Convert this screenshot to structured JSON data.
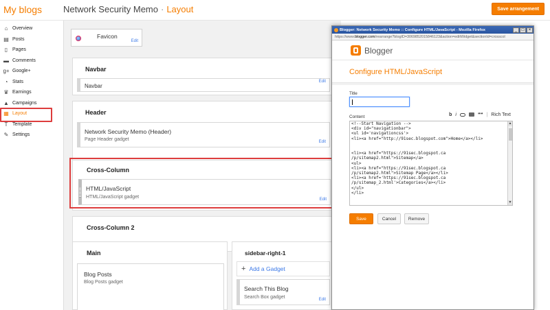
{
  "header": {
    "brand": "My blogs",
    "blog_name": "Network Security Memo",
    "separator": "·",
    "section": "Layout",
    "save_button": "Save arrangement"
  },
  "sidebar": {
    "items": [
      {
        "label": "Overview",
        "icon": "home-icon"
      },
      {
        "label": "Posts",
        "icon": "posts-icon"
      },
      {
        "label": "Pages",
        "icon": "pages-icon"
      },
      {
        "label": "Comments",
        "icon": "comments-icon"
      },
      {
        "label": "Google+",
        "icon": "googleplus-icon"
      },
      {
        "label": "Stats",
        "icon": "stats-icon"
      },
      {
        "label": "Earnings",
        "icon": "trophy-icon"
      },
      {
        "label": "Campaigns",
        "icon": "campaigns-icon"
      },
      {
        "label": "Layout",
        "icon": "layout-icon",
        "active": true
      },
      {
        "label": "Template",
        "icon": "template-icon"
      },
      {
        "label": "Settings",
        "icon": "wrench-icon"
      }
    ]
  },
  "layout": {
    "favicon": {
      "title": "Favicon",
      "edit": "Edit"
    },
    "navbar": {
      "section": "Navbar",
      "gadget_title": "Navbar",
      "edit": "Edit"
    },
    "header": {
      "section": "Header",
      "gadget_title": "Network Security Memo (Header)",
      "gadget_sub": "Page Header gadget",
      "edit": "Edit"
    },
    "cross_column": {
      "section": "Cross-Column",
      "gadget_title": "HTML/JavaScript",
      "gadget_sub": "HTML/JavaScript gadget",
      "edit": "Edit"
    },
    "cross_column_2": {
      "section": "Cross-Column 2"
    },
    "main": {
      "section": "Main",
      "gadget_title": "Blog Posts",
      "gadget_sub": "Blog Posts gadget"
    },
    "sidebar_right": {
      "section": "sidebar-right-1",
      "add_gadget": "Add a Gadget",
      "gadget_title": "Search This Blog",
      "gadget_sub": "Search Box gadget",
      "edit": "Edit"
    }
  },
  "popup": {
    "window_title": "Blogger: Network Security Memo :: Configure HTML/JavaScript - Mozilla Firefox",
    "url_prefix": "https://www.",
    "url_host": "blogger.com",
    "url_rest": "/rearrange?blogID=3069852015846123&action=editWidget&sectionId=crosscol",
    "logo_text": "Blogger",
    "heading": "Configure HTML/JavaScript",
    "title_label": "Title",
    "title_value": "",
    "content_label": "Content",
    "format": {
      "bold": "b",
      "italic": "i",
      "link": "link-icon",
      "image": "image-icon",
      "quote": "❝❝",
      "rich_text": "Rich Text"
    },
    "code_lines": [
      "<!--Start Navigation -->",
      "<div id=\"navigationbar\">",
      "<ul id='navigationcss'>",
      "<li><a href=\"http://91sec.blogspot.com\">Home</a></li>",
      "",
      "",
      "<li><a href=\"https://91sec.blogspot.ca",
      "/p/sitemap2.html\">Sitemap</a>",
      "<ul>",
      "<li><a href=\"https://91sec.blogspot.ca",
      "/p/sitemap2.html\">Sitemap Page</a></li>",
      "<li><a href='https://91sec.blogspot.ca",
      "/p/sitemap_2.html'>Categories</a></li>",
      "</ul>",
      "</li>"
    ],
    "buttons": {
      "save": "Save",
      "cancel": "Cancel",
      "remove": "Remove"
    }
  },
  "colors": {
    "accent": "#f57d00",
    "highlight": "#dd3c3c",
    "link": "#3b78e7"
  }
}
